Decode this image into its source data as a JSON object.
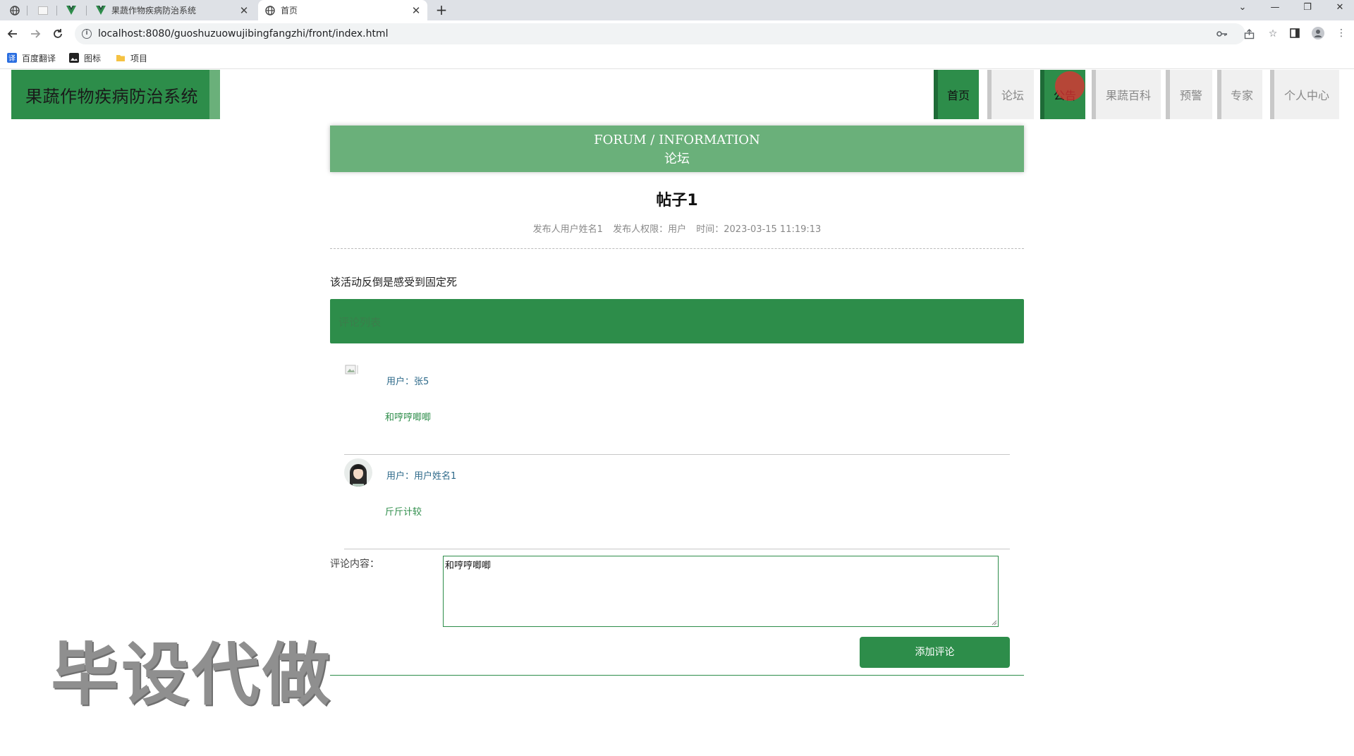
{
  "browser": {
    "tabs": [
      {
        "title": "果蔬作物疾病防治系统",
        "active": false
      },
      {
        "title": "首页",
        "active": true
      }
    ],
    "url": "localhost:8080/guoshuzuowujibingfangzhi/front/index.html",
    "bookmarks": [
      "百度翻译",
      "图标",
      "项目"
    ]
  },
  "site": {
    "logo": "果蔬作物疾病防治系统",
    "nav": [
      {
        "label": "首页",
        "active": true
      },
      {
        "label": "论坛",
        "active": false
      },
      {
        "label": "公告",
        "active": true
      },
      {
        "label": "果蔬百科",
        "active": false
      },
      {
        "label": "预警",
        "active": false
      },
      {
        "label": "专家",
        "active": false
      },
      {
        "label": "个人中心",
        "active": false
      }
    ]
  },
  "banner": {
    "en": "FORUM / INFORMATION",
    "cn": "论坛"
  },
  "post": {
    "title": "帖子1",
    "author": "发布人用户姓名1",
    "role": "发布人权限：用户",
    "time": "时间：2023-03-15 11:19:13",
    "content": "该活动反倒是感受到固定死"
  },
  "comments": {
    "header": "评论列表",
    "items": [
      {
        "user": "用户：张5",
        "text": "和哼哼唧唧"
      },
      {
        "user": "用户：用户姓名1",
        "text": "斤斤计较"
      }
    ]
  },
  "form": {
    "label": "评论内容：",
    "value": "和哼哼唧唧",
    "submit": "添加评论"
  },
  "watermark": "毕设代做",
  "colors": {
    "primary": "#2d8d4a",
    "banner": "#6ab07a",
    "cursor": "#dc3232"
  }
}
